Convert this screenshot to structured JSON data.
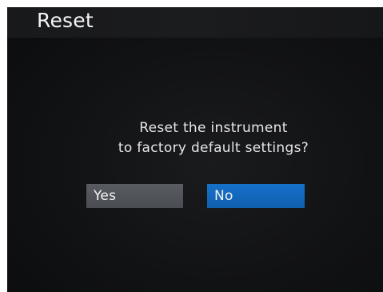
{
  "header": {
    "title": "Reset"
  },
  "dialog": {
    "message_line_1": "Reset the instrument",
    "message_line_2": "to factory default settings?",
    "yes_label": "Yes",
    "no_label": "No",
    "selected_option": "No"
  },
  "colors": {
    "background": "#111214",
    "title_bar": "#1a1b1d",
    "yes_button": "#4f5358",
    "no_button_selected": "#1267bd",
    "text": "#f0f0f0"
  }
}
